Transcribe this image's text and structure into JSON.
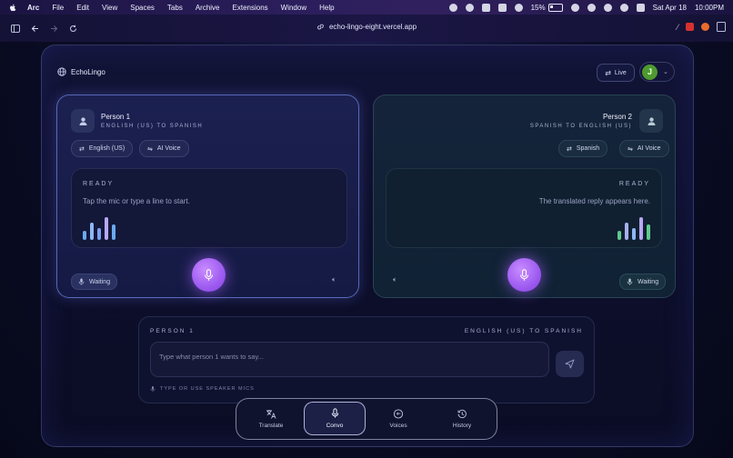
{
  "menubar": {
    "app_name": "Arc",
    "items": [
      "File",
      "Edit",
      "View",
      "Spaces",
      "Tabs",
      "Archive",
      "Extensions",
      "Window",
      "Help"
    ],
    "battery": "15%",
    "date": "Sat Apr 18",
    "time": "10:00PM"
  },
  "browser": {
    "url": "echo-lingo-eight.vercel.app"
  },
  "header": {
    "brand": "EchoLingo",
    "live_label": "Live",
    "avatar_initial": "J"
  },
  "person1": {
    "name": "Person 1",
    "direction": "ENGLISH (US) TO SPANISH",
    "language_chip": "English (US)",
    "voice_chip": "AI Voice",
    "state": "READY",
    "hint": "Tap the mic or type a line to start.",
    "status": "Waiting"
  },
  "person2": {
    "name": "Person 2",
    "direction": "SPANISH TO ENGLISH (US)",
    "language_chip": "Spanish",
    "voice_chip": "AI Voice",
    "state": "READY",
    "hint": "The translated reply appears here.",
    "status": "Waiting"
  },
  "composer": {
    "speaker_label": "PERSON 1",
    "direction_label": "ENGLISH (US) TO SPANISH",
    "placeholder": "Type what person 1 wants to say...",
    "footer": "TYPE OR USE SPEAKER MICS"
  },
  "nav": {
    "items": [
      "Translate",
      "Convo",
      "Voices",
      "History"
    ],
    "active": "Convo"
  },
  "colors": {
    "accent_purple": "#9d5bf0",
    "avatar_green": "#4e9a30",
    "wave_blue": "#6aa9f0",
    "wave_green": "#5fc98e"
  }
}
